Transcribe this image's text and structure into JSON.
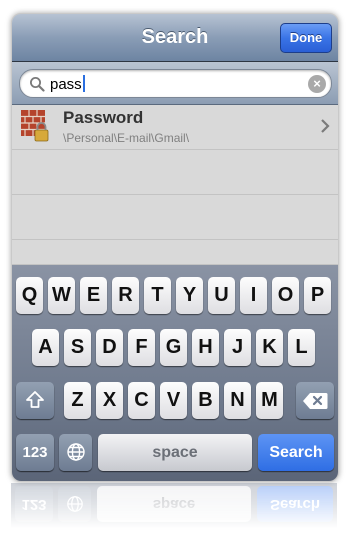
{
  "navbar": {
    "title": "Search",
    "done_label": "Done"
  },
  "search": {
    "value": "pass",
    "search_icon": "search-icon",
    "clear_icon": "clear-icon"
  },
  "results": [
    {
      "title": "Password",
      "path": "\\Personal\\E-mail\\Gmail\\",
      "icon": "locked-brick-wall-icon"
    }
  ],
  "keyboard": {
    "row1": [
      "Q",
      "W",
      "E",
      "R",
      "T",
      "Y",
      "U",
      "I",
      "O",
      "P"
    ],
    "row2": [
      "A",
      "S",
      "D",
      "F",
      "G",
      "H",
      "J",
      "K",
      "L"
    ],
    "row3": [
      "Z",
      "X",
      "C",
      "V",
      "B",
      "N",
      "M"
    ],
    "numbers_label": "123",
    "space_label": "space",
    "search_label": "Search",
    "shift_icon": "shift-icon",
    "globe_icon": "globe-icon",
    "backspace_icon": "backspace-icon"
  },
  "colors": {
    "accent": "#2f6ee4",
    "navbar": "#8a9db6"
  }
}
